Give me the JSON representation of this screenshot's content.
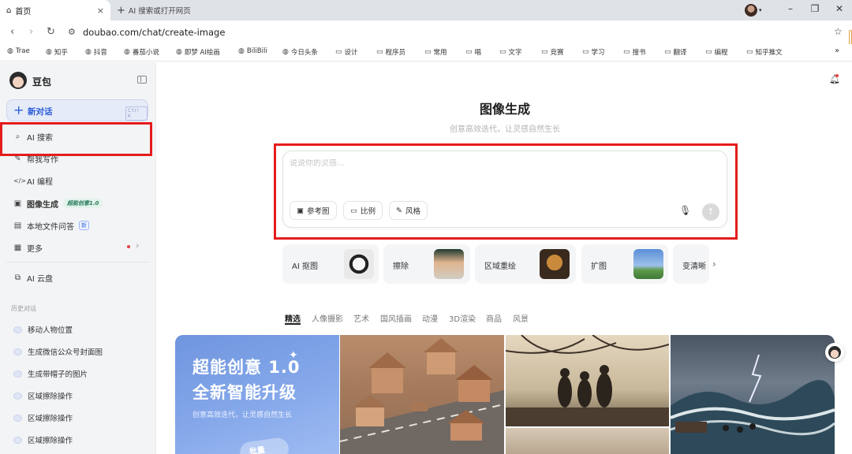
{
  "browser": {
    "tab_active": "首页",
    "tab_new": "AI 搜索或打开网页",
    "url": "doubao.com/chat/create-image",
    "bookmarks": [
      "Trae",
      "知乎",
      "抖音",
      "番茄小说",
      "即梦 AI绘画",
      "BiliBili",
      "今日头条",
      "设计",
      "程序员",
      "常用",
      "唱",
      "文字",
      "竞赛",
      "学习",
      "搜书",
      "翻译",
      "编程",
      "知乎推文"
    ]
  },
  "sidebar": {
    "brand": "豆包",
    "new_chat": "新对话",
    "new_chat_shortcut": "Ctrl K",
    "items": [
      {
        "label": "AI 搜索",
        "icon": "search-icon"
      },
      {
        "label": "帮我写作",
        "icon": "pen-icon"
      },
      {
        "label": "AI 编程",
        "icon": "code-icon"
      },
      {
        "label": "图像生成",
        "icon": "image-icon",
        "badge": "超能创意1.0"
      },
      {
        "label": "本地文件问答",
        "icon": "file-icon",
        "badge": "新"
      },
      {
        "label": "更多",
        "icon": "grid-icon"
      },
      {
        "label": "AI 云盘",
        "icon": "cloud-drive-icon"
      }
    ],
    "history_title": "历史对话",
    "history": [
      "移动人物位置",
      "生成微信公众号封面图",
      "生成带帽子的图片",
      "区域擦除操作",
      "区域擦除操作",
      "区域擦除操作"
    ]
  },
  "main": {
    "title": "图像生成",
    "subtitle": "创意高效迭代，让灵感自然生长",
    "prompt_placeholder": "说说你的灵感...",
    "prompt_buttons": [
      "参考图",
      "比例",
      "风格"
    ],
    "tools": [
      "AI 抠图",
      "擦除",
      "区域重绘",
      "扩图",
      "变清晰"
    ],
    "categories": [
      "精选",
      "人像摄影",
      "艺术",
      "国风插画",
      "动漫",
      "3D渲染",
      "商品",
      "风景"
    ],
    "promo": {
      "line1": "超能创意 1.0",
      "line2": "全新智能升级",
      "sub": "创意高效迭代，让灵感自然生长",
      "button": "批量"
    }
  },
  "colors": {
    "accent": "#2a5bd7",
    "highlight_box": "#e51c1c",
    "sidebar_bg": "#f3f4f6"
  }
}
